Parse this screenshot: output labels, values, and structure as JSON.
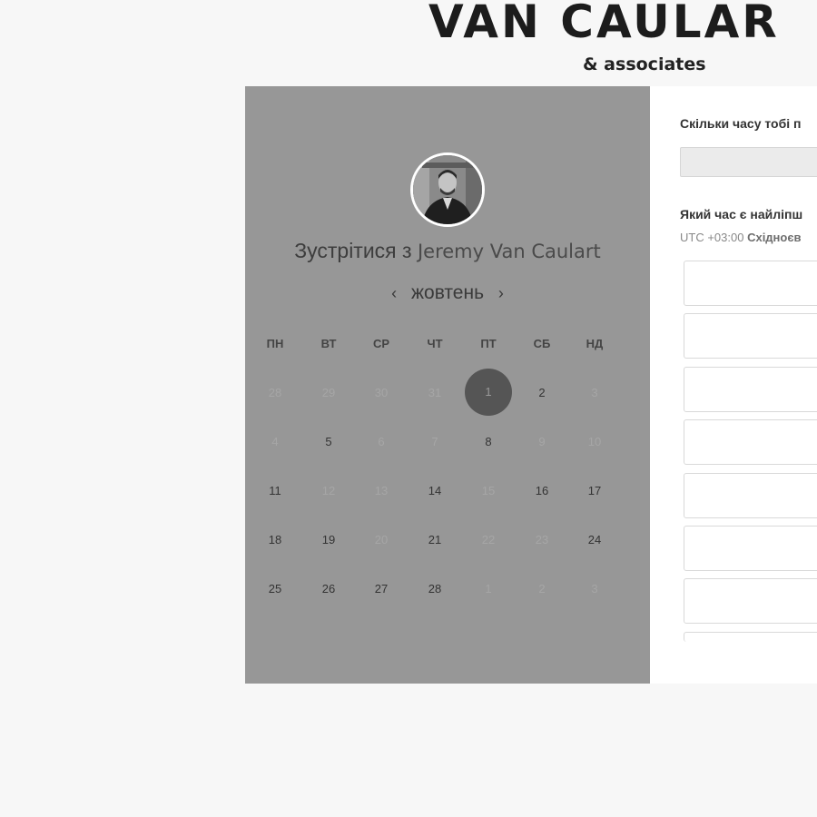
{
  "brand": {
    "title": "VAN CAULAR",
    "tagline": "& associates"
  },
  "booking": {
    "host_prefix": "Зустрітися з",
    "host_name": "Jeremy Van Caulart",
    "month": "жовтень",
    "prev_icon": "‹",
    "next_icon": "›",
    "weekdays": [
      "ПН",
      "ВТ",
      "СР",
      "ЧТ",
      "ПТ",
      "СБ",
      "НД"
    ],
    "weeks": [
      [
        {
          "d": "28",
          "m": true
        },
        {
          "d": "29",
          "m": true
        },
        {
          "d": "30",
          "m": true
        },
        {
          "d": "31",
          "m": true
        },
        {
          "d": "1",
          "sel": true
        },
        {
          "d": "2"
        },
        {
          "d": "3",
          "m": true
        }
      ],
      [
        {
          "d": "4",
          "m": true
        },
        {
          "d": "5"
        },
        {
          "d": "6",
          "m": true
        },
        {
          "d": "7",
          "m": true
        },
        {
          "d": "8"
        },
        {
          "d": "9",
          "m": true
        },
        {
          "d": "10",
          "m": true
        }
      ],
      [
        {
          "d": "11"
        },
        {
          "d": "12",
          "m": true
        },
        {
          "d": "13",
          "m": true
        },
        {
          "d": "14"
        },
        {
          "d": "15",
          "m": true
        },
        {
          "d": "16"
        },
        {
          "d": "17"
        }
      ],
      [
        {
          "d": "18"
        },
        {
          "d": "19"
        },
        {
          "d": "20",
          "m": true
        },
        {
          "d": "21"
        },
        {
          "d": "22",
          "m": true
        },
        {
          "d": "23",
          "m": true
        },
        {
          "d": "24"
        }
      ],
      [
        {
          "d": "25"
        },
        {
          "d": "26"
        },
        {
          "d": "27"
        },
        {
          "d": "28"
        },
        {
          "d": "1",
          "m": true
        },
        {
          "d": "2",
          "m": true
        },
        {
          "d": "3",
          "m": true
        }
      ]
    ]
  },
  "form": {
    "duration_question": "Скільки часу тобі п",
    "duration_value": "",
    "time_question": "Який час є найліпш",
    "tz_offset": "UTC +03:00",
    "tz_name": "Східноєв",
    "slot_count": 8
  }
}
